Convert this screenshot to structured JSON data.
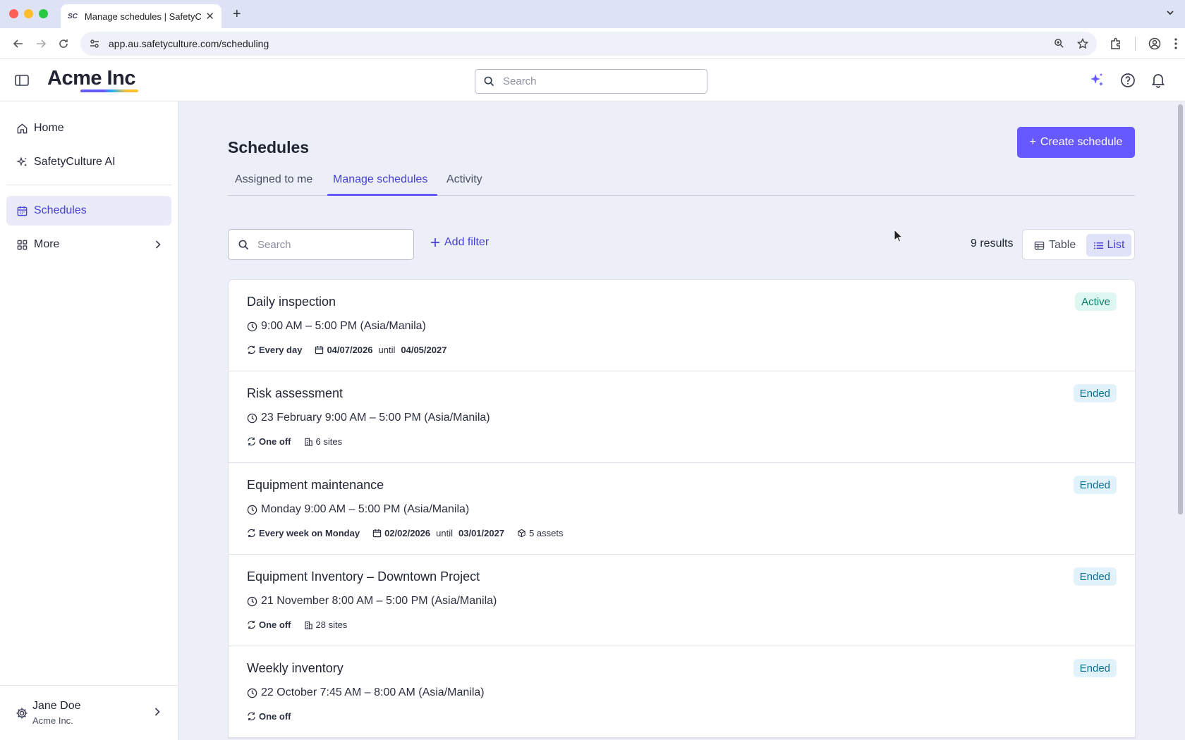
{
  "browser": {
    "tab_title": "Manage schedules | SafetyCu",
    "favicon_text": "SC",
    "url": "app.au.safetyculture.com/scheduling",
    "traffic_colors": [
      "#ff5f57",
      "#febc2e",
      "#28c840"
    ]
  },
  "header": {
    "logo": "Acme Inc",
    "search_placeholder": "Search",
    "icons": [
      "sparkle-icon",
      "help-icon",
      "bell-icon"
    ],
    "accent": "#6559ff"
  },
  "sidebar": {
    "items": [
      {
        "label": "Home",
        "icon": "home-icon"
      },
      {
        "label": "SafetyCulture AI",
        "icon": "sparkle-icon"
      },
      {
        "label": "Schedules",
        "icon": "calendar-icon",
        "active": true
      },
      {
        "label": "More",
        "icon": "grid-icon"
      }
    ],
    "user": {
      "name": "Jane Doe",
      "org": "Acme Inc."
    }
  },
  "main": {
    "title": "Schedules",
    "create_label": "Create schedule",
    "tabs": [
      {
        "label": "Assigned to me"
      },
      {
        "label": "Manage schedules",
        "active": true
      },
      {
        "label": "Activity"
      }
    ],
    "search_placeholder": "Search",
    "add_filter_label": "Add filter",
    "results_label": "9 results",
    "view_table_label": "Table",
    "view_list_label": "List",
    "view_selected": "List"
  },
  "schedules": [
    {
      "title": "Daily inspection",
      "time": "9:00 AM – 5:00 PM (Asia/Manila)",
      "recurrence": "Every day",
      "date_start": "04/07/2026",
      "until": "until",
      "date_end": "04/05/2027",
      "status": "Active"
    },
    {
      "title": "Risk assessment",
      "time": "23 February 9:00 AM – 5:00 PM (Asia/Manila)",
      "recurrence": "One off",
      "sites": "6 sites",
      "status": "Ended"
    },
    {
      "title": "Equipment maintenance",
      "time": "Monday 9:00 AM – 5:00 PM (Asia/Manila)",
      "recurrence": "Every week on Monday",
      "date_start": "02/02/2026",
      "until": "until",
      "date_end": "03/01/2027",
      "assets": "5 assets",
      "status": "Ended"
    },
    {
      "title": "Equipment Inventory – Downtown Project",
      "time": "21 November 8:00 AM – 5:00 PM (Asia/Manila)",
      "recurrence": "One off",
      "sites": "28 sites",
      "status": "Ended"
    },
    {
      "title": "Weekly inventory",
      "time": "22 October 7:45 AM – 8:00 AM (Asia/Manila)",
      "recurrence": "One off",
      "status": "Ended"
    }
  ]
}
